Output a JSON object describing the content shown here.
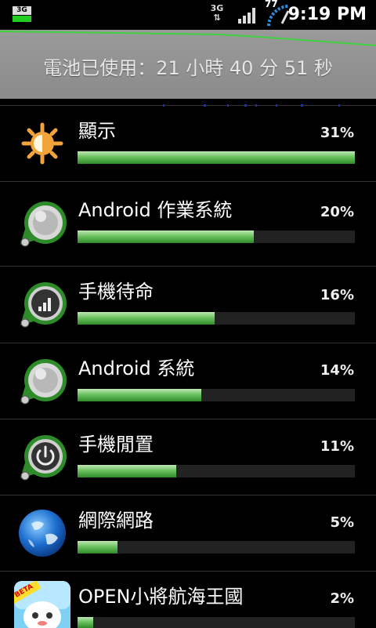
{
  "status_bar": {
    "left_network": "3G",
    "right_network": "3G",
    "battery_level": "77",
    "time": "9:19 PM"
  },
  "summary": {
    "battery_usage_text": "電池已使用：21 小時 40 分 51 秒"
  },
  "items": [
    {
      "name": "顯示",
      "percent": "31%",
      "level": 1.0,
      "icon": "sun-icon"
    },
    {
      "name": "Android 作業系統",
      "percent": "20%",
      "level": 0.636,
      "icon": "android-os-icon"
    },
    {
      "name": "手機待命",
      "percent": "16%",
      "level": 0.495,
      "icon": "cell-standby-icon"
    },
    {
      "name": "Android 系統",
      "percent": "14%",
      "level": 0.446,
      "icon": "android-system-icon"
    },
    {
      "name": "手機閒置",
      "percent": "11%",
      "level": 0.356,
      "icon": "power-idle-icon"
    },
    {
      "name": "網際網路",
      "percent": "5%",
      "level": 0.144,
      "icon": "globe-icon"
    },
    {
      "name": "OPEN小將航海王國",
      "percent": "2%",
      "level": 0.057,
      "icon": "app-beta-icon"
    }
  ],
  "app_icon_badge": "BETA"
}
